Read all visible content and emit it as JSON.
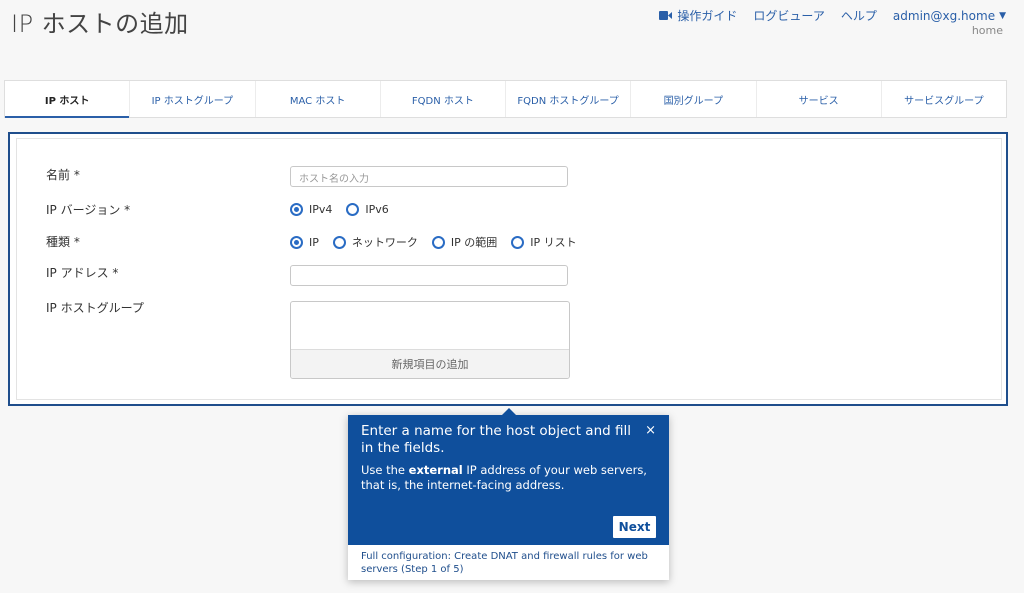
{
  "page": {
    "title": "IP ホストの追加"
  },
  "topnav": {
    "guide": "操作ガイド",
    "log_viewer": "ログビューア",
    "help": "ヘルプ",
    "user": "admin@xg.home",
    "subtext": "home"
  },
  "tabs": [
    {
      "label": "IP ホスト",
      "active": true
    },
    {
      "label": "IP ホストグループ"
    },
    {
      "label": "MAC ホスト"
    },
    {
      "label": "FQDN ホスト"
    },
    {
      "label": "FQDN ホストグループ"
    },
    {
      "label": "国別グループ"
    },
    {
      "label": "サービス"
    },
    {
      "label": "サービスグループ"
    }
  ],
  "form": {
    "name_label": "名前 *",
    "name_placeholder": "ホスト名の入力",
    "ip_version_label": "IP バージョン *",
    "ip_version_options": [
      "IPv4",
      "IPv6"
    ],
    "ip_version_selected": "IPv4",
    "type_label": "種類 *",
    "type_options": [
      "IP",
      "ネットワーク",
      "IP の範囲",
      "IP リスト"
    ],
    "type_selected": "IP",
    "ip_address_label": "IP アドレス *",
    "ip_address_value": "",
    "host_group_label": "IP ホストグループ",
    "add_new_item": "新規項目の追加"
  },
  "tooltip": {
    "title": "Enter a name for the host object and fill in the fields.",
    "text_before": "Use the ",
    "text_bold": "external",
    "text_after": " IP address of your web servers, that is, the internet-facing address.",
    "close": "×",
    "next": "Next",
    "footer": "Full configuration: Create DNAT and firewall rules for web servers (Step 1 of 5)"
  },
  "colors": {
    "accent": "#2a5fa8",
    "panel_border": "#1f4e8c",
    "tooltip_bg": "#0f4f9c"
  }
}
